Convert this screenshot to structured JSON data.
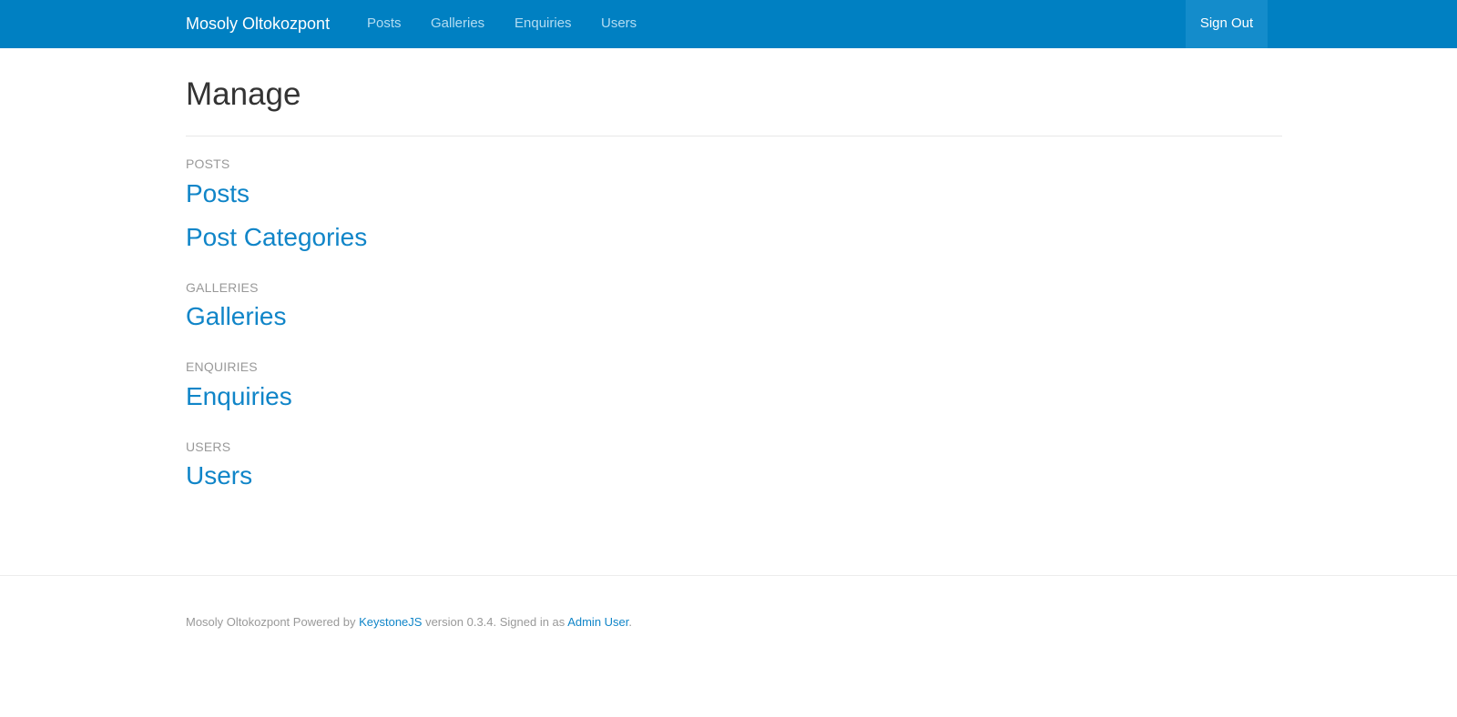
{
  "navbar": {
    "brand": "Mosoly Oltokozpont",
    "links": [
      "Posts",
      "Galleries",
      "Enquiries",
      "Users"
    ],
    "signout_label": "Sign Out",
    "colors": {
      "background": "#0080c2",
      "link": "#b3dcf2",
      "active_bg": "#148ccb"
    }
  },
  "main": {
    "title": "Manage",
    "sections": [
      {
        "heading": "POSTS",
        "links": [
          "Posts",
          "Post Categories"
        ]
      },
      {
        "heading": "GALLERIES",
        "links": [
          "Galleries"
        ]
      },
      {
        "heading": "ENQUIRIES",
        "links": [
          "Enquiries"
        ]
      },
      {
        "heading": "USERS",
        "links": [
          "Users"
        ]
      }
    ]
  },
  "footer": {
    "site_name": "Mosoly Oltokozpont",
    "powered_by": "Powered by",
    "framework_link": "KeystoneJS",
    "version_text": "version 0.3.4. Signed in as",
    "user_link": "Admin User",
    "end_period": "."
  }
}
